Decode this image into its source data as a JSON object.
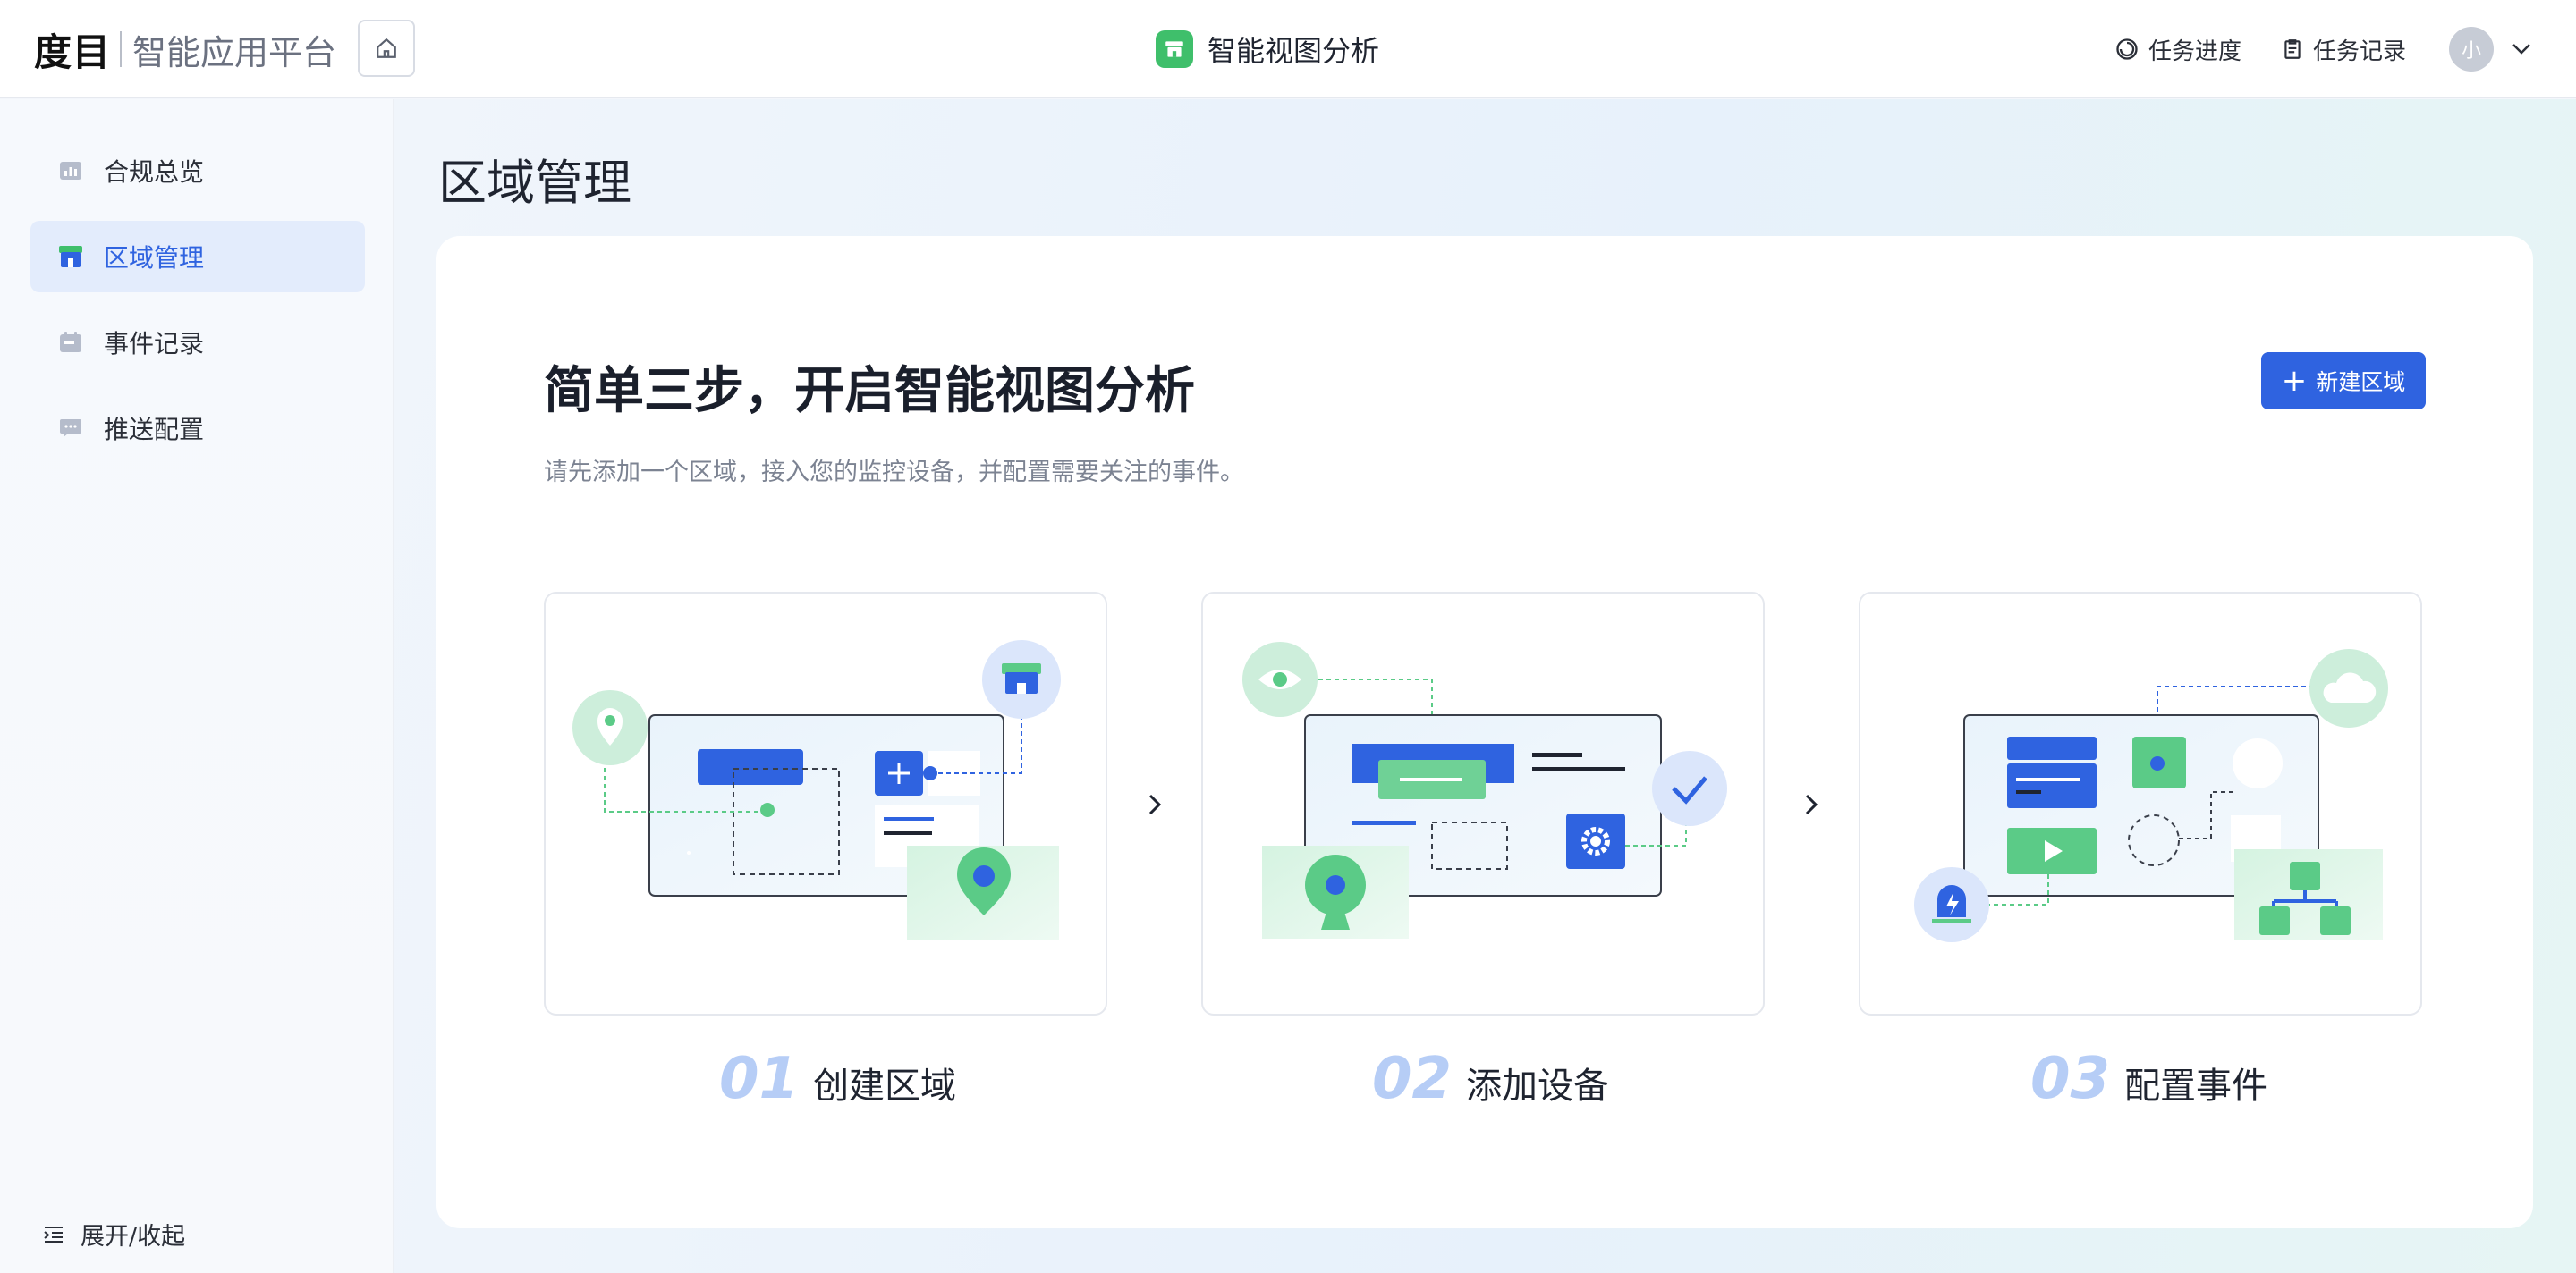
{
  "header": {
    "logo": "度目",
    "platform_name": "智能应用平台",
    "app_title": "智能视图分析",
    "task_progress": "任务进度",
    "task_records": "任务记录",
    "avatar_text": "小"
  },
  "sidebar": {
    "items": [
      {
        "label": "合规总览",
        "icon": "chart-icon"
      },
      {
        "label": "区域管理",
        "icon": "store-icon",
        "active": true
      },
      {
        "label": "事件记录",
        "icon": "calendar-icon"
      },
      {
        "label": "推送配置",
        "icon": "message-icon"
      }
    ],
    "toggle_label": "展开/收起"
  },
  "main": {
    "page_title": "区域管理",
    "hero_title": "简单三步，开启智能视图分析",
    "hero_subtitle": "请先添加一个区域，接入您的监控设备，并配置需要关注的事件。",
    "new_button_label": "新建区域",
    "steps": [
      {
        "num": "01",
        "label": "创建区域"
      },
      {
        "num": "02",
        "label": "添加设备"
      },
      {
        "num": "03",
        "label": "配置事件"
      }
    ]
  },
  "colors": {
    "primary": "#2f63e0",
    "green": "#3fbf6b",
    "step_number": "#b6cdf6"
  }
}
